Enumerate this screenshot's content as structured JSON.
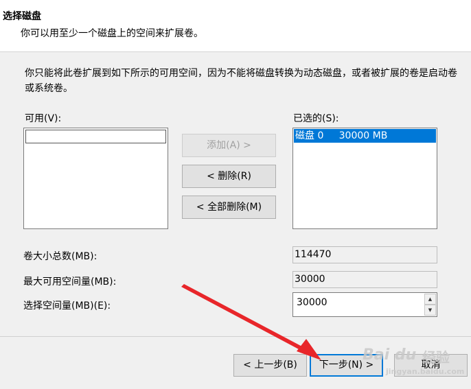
{
  "header": {
    "title": "选择磁盘",
    "subtitle": "你可以用至少一个磁盘上的空间来扩展卷。"
  },
  "description": "你只能将此卷扩展到如下所示的可用空间，因为不能将磁盘转换为动态磁盘，或者被扩展的卷是启动卷或系统卷。",
  "available": {
    "label": "可用(V):",
    "items": []
  },
  "selected": {
    "label": "已选的(S):",
    "items": [
      {
        "disk": "磁盘 0",
        "size": "30000 MB"
      }
    ]
  },
  "buttons": {
    "add": "添加(A) >",
    "remove": "< 删除(R)",
    "remove_all": "< 全部删除(M)"
  },
  "fields": {
    "total_label": "卷大小总数(MB):",
    "total_value": "114470",
    "max_label": "最大可用空间量(MB):",
    "max_value": "30000",
    "select_label": "选择空间量(MB)(E):",
    "select_value": "30000"
  },
  "footer": {
    "back": "< 上一步(B)",
    "next": "下一步(N) >",
    "cancel": "取消"
  },
  "watermark": {
    "logo": "Bai du",
    "text": "经验",
    "url": "jingyan.baidu.com"
  },
  "colors": {
    "selection": "#0078d7",
    "annotation_arrow": "#e8262a"
  }
}
